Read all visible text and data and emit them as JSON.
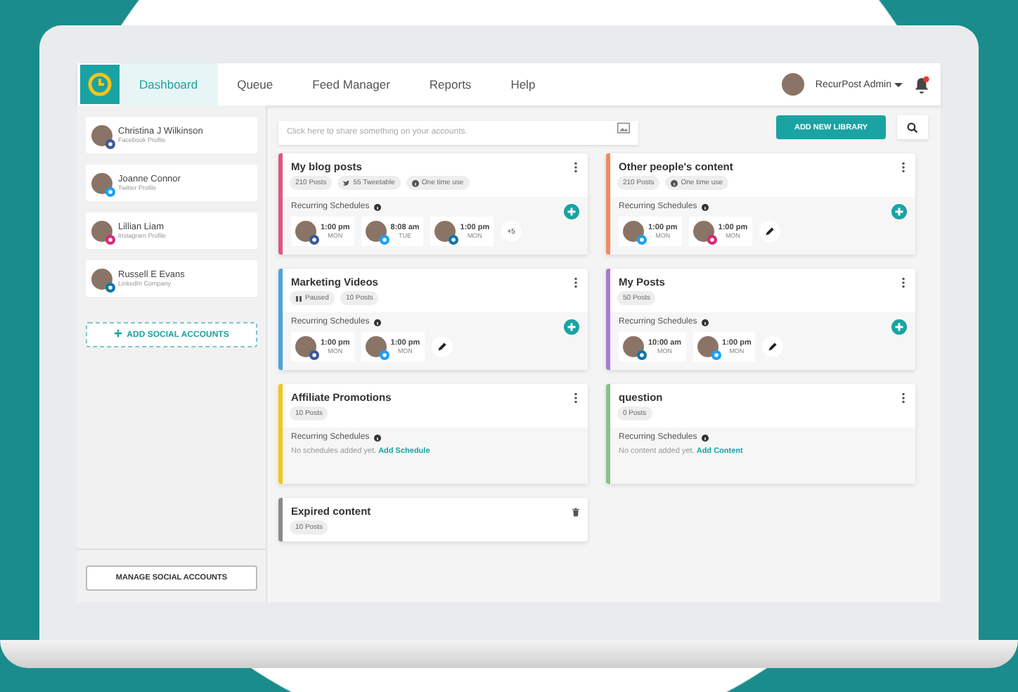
{
  "nav": {
    "tabs": [
      {
        "label": "Dashboard",
        "selected": true
      },
      {
        "label": "Queue",
        "selected": false
      },
      {
        "label": "Feed Manager",
        "selected": false
      },
      {
        "label": "Reports",
        "selected": false
      },
      {
        "label": "Help",
        "selected": false
      }
    ],
    "user": "RecurPost Admin"
  },
  "sidebar": {
    "accounts": [
      {
        "name": "Christina J Wilkinson",
        "type": "Facebook Profile",
        "kind": "facebook"
      },
      {
        "name": "Joanne Connor",
        "type": "Twitter Profile",
        "kind": "twitter"
      },
      {
        "name": "Lillian Liam",
        "type": "Instagram Profile",
        "kind": "instagram"
      },
      {
        "name": "Russell E Evans",
        "type": "LinkedIn Company",
        "kind": "linkedin"
      }
    ],
    "add_button": "ADD SOCIAL ACCOUNTS",
    "manage_button": "MANAGE SOCIAL ACCOUNTS"
  },
  "share": {
    "placeholder": "Click here to share something on your accounts."
  },
  "add_library_button": "ADD NEW LIBRARY",
  "library_columns": [
    [
      {
        "title": "My blog posts",
        "kind": "active",
        "color": "#e0557f",
        "tags": [
          {
            "text": "210 Posts",
            "kind": "plain"
          },
          {
            "text": "55 Tweetable",
            "kind": "tweetable"
          },
          {
            "text": "One time use",
            "kind": "onetime"
          }
        ],
        "schedules_label": "Recurring Schedules",
        "slots": [
          {
            "time": "1:00 pm",
            "day": "MON",
            "kind": "facebook"
          },
          {
            "time": "8:08 am",
            "day": "TUE",
            "kind": "twitter"
          },
          {
            "time": "1:00 pm",
            "day": "MON",
            "kind": "linkedin"
          }
        ],
        "more": "+5"
      },
      {
        "title": "Marketing Videos",
        "kind": "active",
        "color": "#4aa3df",
        "tags": [
          {
            "text": "Paused",
            "kind": "paused"
          },
          {
            "text": "10 Posts",
            "kind": "plain"
          }
        ],
        "schedules_label": "Recurring Schedules",
        "slots": [
          {
            "time": "1:00 pm",
            "day": "MON",
            "kind": "facebook"
          },
          {
            "time": "1:00 pm",
            "day": "MON",
            "kind": "twitter"
          }
        ],
        "edit": true
      },
      {
        "title": "Affiliate Promotions",
        "kind": "active",
        "color": "#f5c518",
        "tags": [
          {
            "text": "10 Posts",
            "kind": "plain"
          }
        ],
        "schedules_label": "Recurring Schedules",
        "empty_text": "No schedules added yet.",
        "empty_link": "Add Schedule"
      },
      {
        "title": "Expired content",
        "kind": "expired",
        "color": "#8a8a8a",
        "tags": [
          {
            "text": "10 Posts",
            "kind": "plain"
          }
        ]
      }
    ],
    [
      {
        "title": "Other people's content",
        "kind": "active",
        "color": "#f08a5d",
        "tags": [
          {
            "text": "210 Posts",
            "kind": "plain"
          },
          {
            "text": "One time use",
            "kind": "onetime"
          }
        ],
        "schedules_label": "Recurring Schedules",
        "slots": [
          {
            "time": "1:00 pm",
            "day": "MON",
            "kind": "twitter"
          },
          {
            "time": "1:00 pm",
            "day": "MON",
            "kind": "instagram"
          }
        ],
        "edit": true
      },
      {
        "title": "My Posts",
        "kind": "active",
        "color": "#a97bd6",
        "tags": [
          {
            "text": "50 Posts",
            "kind": "plain"
          }
        ],
        "schedules_label": "Recurring Schedules",
        "slots": [
          {
            "time": "10:00 am",
            "day": "MON",
            "kind": "linkedin"
          },
          {
            "time": "1:00 pm",
            "day": "MON",
            "kind": "twitter"
          }
        ],
        "edit": true
      },
      {
        "title": "question",
        "kind": "active",
        "color": "#8dbf8b",
        "tags": [
          {
            "text": "0 Posts",
            "kind": "plain"
          }
        ],
        "schedules_label": "Recurring Schedules",
        "empty_text": "No content added yet.",
        "empty_link": "Add Content"
      }
    ]
  ]
}
